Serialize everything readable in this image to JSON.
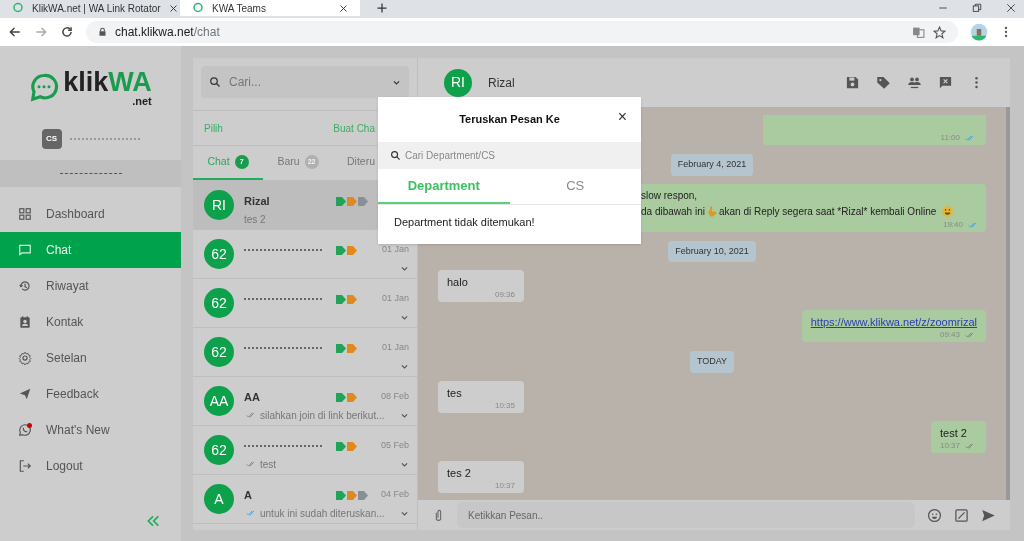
{
  "browser": {
    "tabs": [
      {
        "title": "KlikWA.net | WA Link Rotator",
        "selected": false
      },
      {
        "title": "KWA Teams",
        "selected": true
      }
    ],
    "url_host": "chat.klikwa.net",
    "url_path": "/chat"
  },
  "sidebar": {
    "logo_text": "klik",
    "logo_accent": "WA",
    "logo_suffix": ".net",
    "user_badge": "CS",
    "items": [
      {
        "label": "Dashboard",
        "selected": false,
        "notification": false
      },
      {
        "label": "Chat",
        "selected": true,
        "notification": false
      },
      {
        "label": "Riwayat",
        "selected": false,
        "notification": false
      },
      {
        "label": "Kontak",
        "selected": false,
        "notification": false
      },
      {
        "label": "Setelan",
        "selected": false,
        "notification": false
      },
      {
        "label": "Feedback",
        "selected": false,
        "notification": false
      },
      {
        "label": "What's New",
        "selected": false,
        "notification": true
      },
      {
        "label": "Logout",
        "selected": false,
        "notification": false
      }
    ]
  },
  "chat_list": {
    "search_placeholder": "Cari...",
    "select_label": "Pilih",
    "new_chat_label": "Buat Cha",
    "tabs": [
      {
        "label": "Chat",
        "count": "7",
        "selected": true
      },
      {
        "label": "Baru",
        "count": "22",
        "selected": false
      },
      {
        "label": "Diteru",
        "selected": false
      }
    ],
    "chats": [
      {
        "avatar": "RI",
        "redacted": false,
        "name": "Rizal",
        "preview": "tes 2",
        "tags": [
          {
            "color": "#21a35a"
          },
          {
            "color": "#e08a1e"
          },
          {
            "color": "#8a8f96"
          }
        ],
        "selected": true
      },
      {
        "avatar": "62",
        "redacted": true,
        "date": "01 Jan",
        "tags": [
          {
            "color": "#21a35a"
          },
          {
            "color": "#e08a1e"
          }
        ],
        "selected": false
      },
      {
        "avatar": "62",
        "redacted": true,
        "date": "01 Jan",
        "tags": [
          {
            "color": "#21a35a"
          },
          {
            "color": "#e08a1e"
          }
        ],
        "selected": false
      },
      {
        "avatar": "62",
        "redacted": true,
        "date": "01 Jan",
        "tags": [
          {
            "color": "#21a35a"
          },
          {
            "color": "#e08a1e"
          }
        ],
        "selected": false
      },
      {
        "avatar": "AA",
        "redacted": false,
        "name": "AA",
        "date": "08 Feb",
        "preview": "silahkan join di link berikut...",
        "ticks_read": false,
        "tags": [
          {
            "color": "#21a35a"
          },
          {
            "color": "#e08a1e"
          }
        ],
        "selected": false
      },
      {
        "avatar": "62",
        "redacted": true,
        "date": "05 Feb",
        "preview": "test",
        "ticks_read": false,
        "tags": [
          {
            "color": "#21a35a"
          },
          {
            "color": "#e08a1e"
          }
        ],
        "selected": false
      },
      {
        "avatar": "A",
        "redacted": false,
        "name": "A",
        "date": "04 Feb",
        "preview": "untuk ini sudah diteruskan...",
        "ticks_read": true,
        "tags": [
          {
            "color": "#21a35a"
          },
          {
            "color": "#e08a1e"
          },
          {
            "color": "#8a8f96"
          }
        ],
        "selected": false
      }
    ]
  },
  "conversation": {
    "avatar": "RI",
    "name": "Rizal",
    "messages": [
      {
        "kind": "out",
        "time": "11:00",
        "ticks_read": true,
        "partial": true
      },
      {
        "kind": "date",
        "text": "February 4, 2021"
      },
      {
        "kind": "out",
        "lines": [
          [
            "slow respon,"
          ],
          [
            "da dibawah ini",
            {
              "kind": "emoji"
            },
            "akan di Reply segera saat *Rizal* kembali Online",
            {
              "kind": "emoji"
            }
          ]
        ],
        "time": "19:40",
        "ticks_read": true,
        "partial": false
      },
      {
        "kind": "date",
        "text": "February 10, 2021"
      },
      {
        "kind": "in",
        "lines": [
          [
            "halo"
          ]
        ],
        "time": "09:36"
      },
      {
        "kind": "link",
        "lines": [
          [
            "https://www.klikwa.net/z/zoomrizal"
          ]
        ],
        "time": "09:43",
        "ticks_read": false
      },
      {
        "kind": "date",
        "text": "TODAY"
      },
      {
        "kind": "in",
        "lines": [
          [
            "tes"
          ]
        ],
        "time": "10:35"
      },
      {
        "kind": "out",
        "lines": [
          [
            "test 2"
          ]
        ],
        "time": "10:37",
        "ticks_read": false
      },
      {
        "kind": "in",
        "lines": [
          [
            "tes 2"
          ]
        ],
        "time": "10:37"
      }
    ],
    "input_placeholder": "Ketikkan Pesan.."
  },
  "dialog": {
    "title": "Teruskan Pesan Ke",
    "close": "×",
    "search_placeholder": "Cari Department/CS",
    "tabs": [
      {
        "label": "Department",
        "selected": true
      },
      {
        "label": "CS",
        "selected": false
      }
    ],
    "empty_message": "Department tidak ditemukan!"
  }
}
